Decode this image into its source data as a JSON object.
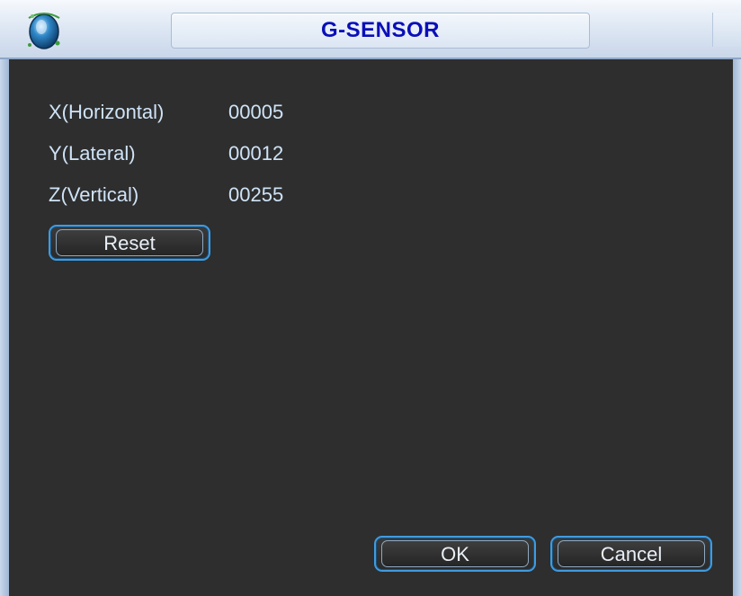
{
  "window": {
    "title": "G-SENSOR",
    "logo_icon": "globe-icon"
  },
  "sensor": {
    "rows": [
      {
        "label": "X(Horizontal)",
        "value": "00005"
      },
      {
        "label": "Y(Lateral)",
        "value": "00012"
      },
      {
        "label": "Z(Vertical)",
        "value": "00255"
      }
    ],
    "reset_label": "Reset"
  },
  "footer": {
    "ok_label": "OK",
    "cancel_label": "Cancel"
  },
  "colors": {
    "title_text": "#0a0fb8",
    "button_border": "#3f9be0",
    "background": "#2e2e2e",
    "label_text": "#cfe3f7"
  }
}
